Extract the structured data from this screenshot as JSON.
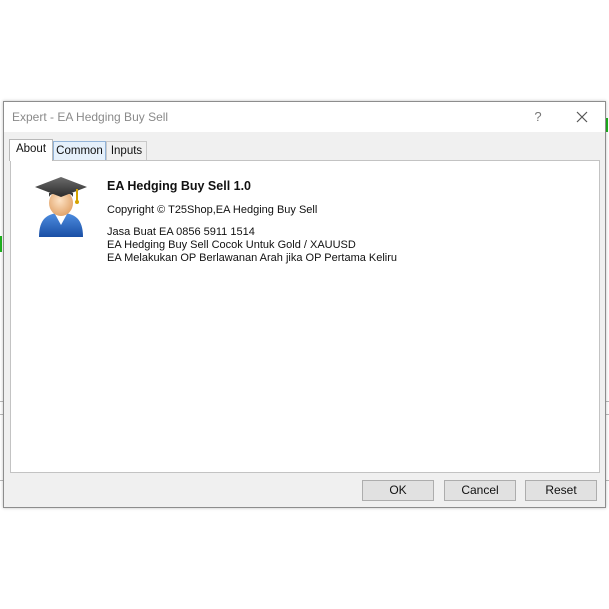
{
  "dialog": {
    "title": "Expert - EA Hedging Buy Sell",
    "help_symbol": "?",
    "close_icon": "close-icon"
  },
  "tabs": [
    {
      "label": "About",
      "active": true
    },
    {
      "label": "Common",
      "active": false
    },
    {
      "label": "Inputs",
      "active": false
    }
  ],
  "about": {
    "icon": "graduate-user-icon",
    "ea_title": "EA Hedging Buy Sell 1.0",
    "copyright": "Copyright © T25Shop,EA Hedging Buy Sell",
    "description": [
      "Jasa Buat EA 0856 5911 1514",
      "EA Hedging Buy Sell Cocok Untuk Gold / XAUUSD",
      "EA Melakukan OP Berlawanan Arah jika OP Pertama Keliru"
    ]
  },
  "buttons": {
    "ok": "OK",
    "cancel": "Cancel",
    "reset": "Reset"
  },
  "colors": {
    "accent_tab": "#e5f0fb",
    "chart_tick": "#1db31d"
  }
}
